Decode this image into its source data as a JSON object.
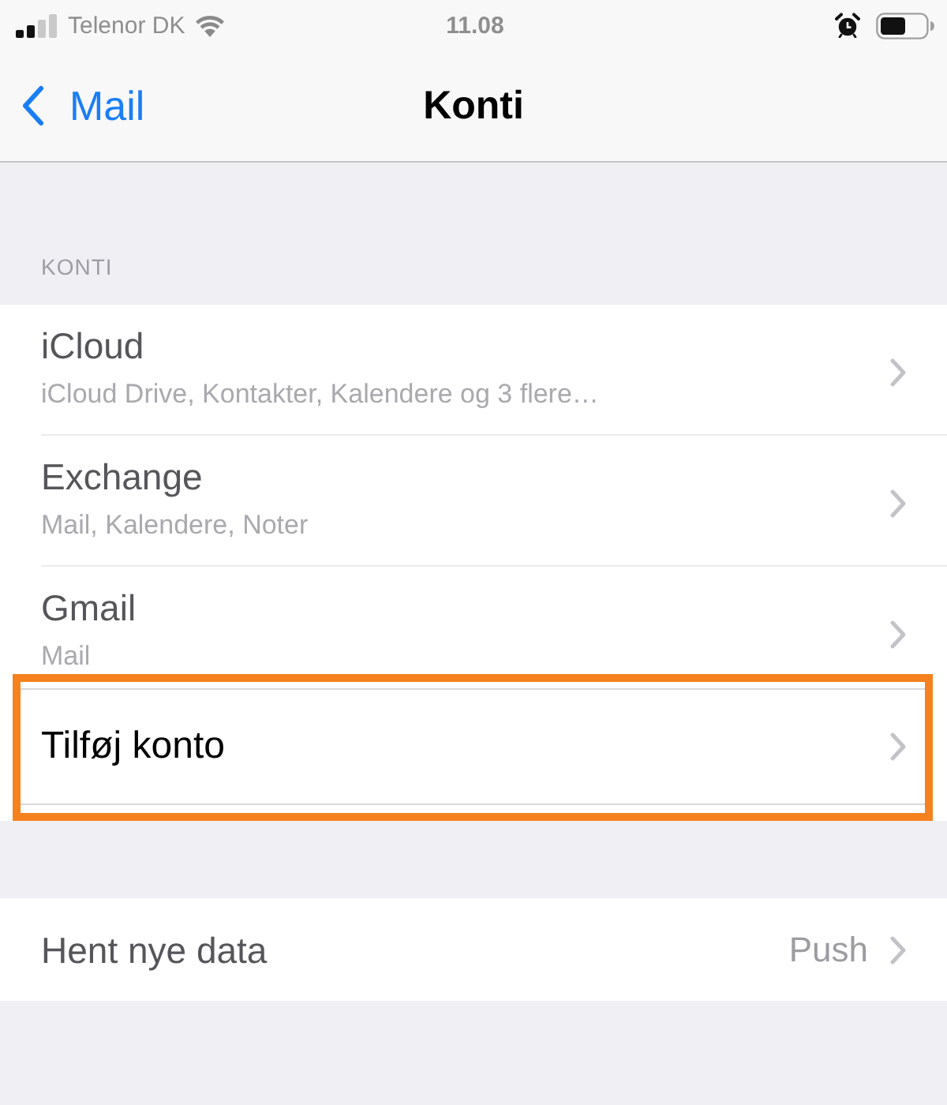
{
  "status_bar": {
    "carrier": "Telenor DK",
    "time": "11.08"
  },
  "nav_bar": {
    "back": "Mail",
    "title": "Konti"
  },
  "sections": [
    {
      "header": "KONTI",
      "rows": [
        {
          "title": "iCloud",
          "subtitle": "iCloud Drive, Kontakter, Kalendere og 3 flere…",
          "highlighted": false
        },
        {
          "title": "Exchange",
          "subtitle": "Mail, Kalendere, Noter",
          "highlighted": false
        },
        {
          "title": "Gmail",
          "subtitle": "Mail",
          "highlighted": false
        },
        {
          "title": "Tilføj konto",
          "highlighted": true
        }
      ]
    },
    {
      "rows": [
        {
          "title": "Hent nye data",
          "value": "Push",
          "highlighted": false
        }
      ]
    }
  ]
}
